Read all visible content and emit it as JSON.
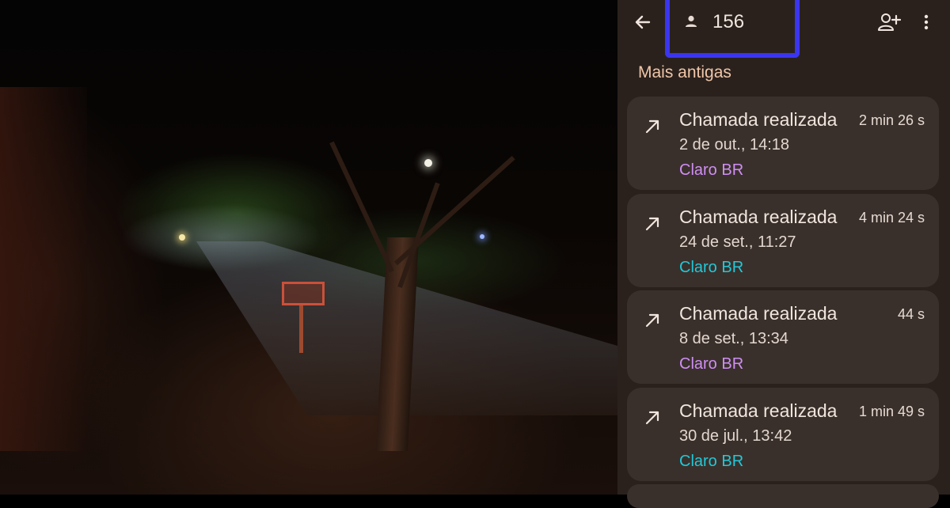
{
  "header": {
    "contact_number": "156"
  },
  "section": {
    "title": "Mais antigas"
  },
  "calls": [
    {
      "title": "Chamada realizada",
      "duration": "2 min 26 s",
      "date": "2 de out., 14:18",
      "carrier": "Claro BR",
      "carrier_color": "#cf8ef5"
    },
    {
      "title": "Chamada realizada",
      "duration": "4 min 24 s",
      "date": "24 de set., 11:27",
      "carrier": "Claro BR",
      "carrier_color": "#22c8d8"
    },
    {
      "title": "Chamada realizada",
      "duration": "44 s",
      "date": "8 de set., 13:34",
      "carrier": "Claro BR",
      "carrier_color": "#cf8ef5"
    },
    {
      "title": "Chamada realizada",
      "duration": "1 min 49 s",
      "date": "30 de jul., 13:42",
      "carrier": "Claro BR",
      "carrier_color": "#22c8d8"
    }
  ],
  "icons": {
    "back": "arrow-left-icon",
    "person": "person-icon",
    "add_contact": "person-add-icon",
    "more": "more-vert-icon",
    "outgoing_call": "arrow-up-right-icon"
  },
  "colors": {
    "panel_bg": "#2a211d",
    "card_bg": "#3a302b",
    "highlight_box": "#3b35f0",
    "section_header": "#f0c6a8"
  }
}
